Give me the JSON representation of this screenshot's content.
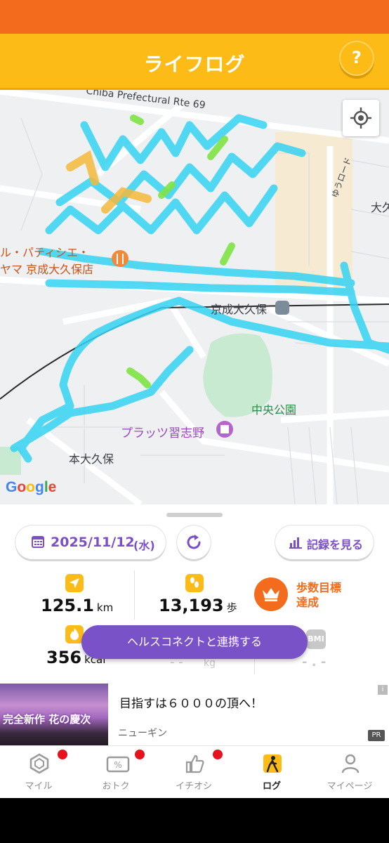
{
  "header": {
    "title": "ライフログ",
    "help_label": "?"
  },
  "map": {
    "labels": {
      "road_name": "Chiba Prefectural Rte 69",
      "yuu_road": "ゆうロード",
      "okubo_partial": "大久",
      "patisserie_line1": "ル・パティシエ・",
      "patisserie_line2": "ヤマ 京成大久保店",
      "station": "京成大久保",
      "park": "中央公園",
      "plats": "プラッツ習志野",
      "honokubo": "本大久保"
    },
    "google_logo": [
      "G",
      "o",
      "o",
      "g",
      "l",
      "e"
    ],
    "colors": {
      "route": "#35d3f3",
      "route_green": "#7ee342",
      "route_orange": "#f6b93b",
      "park": "#c8ead0"
    }
  },
  "panel": {
    "date": "2025/11/12",
    "day_of_week": "(水)",
    "record_label": "記録を見る",
    "distance": {
      "value": "125.1",
      "unit": "km"
    },
    "steps": {
      "value": "13,193",
      "unit": "歩"
    },
    "goal": {
      "line1": "歩数目標",
      "line2": "達成"
    },
    "calories": {
      "value": "356",
      "unit": "kcal"
    },
    "weight": {
      "value": "- -",
      "unit": "kg"
    },
    "bmi": {
      "label": "BMI",
      "value": "- . -"
    },
    "health_connect_label": "ヘルスコネクトと連携する"
  },
  "ad": {
    "image_text": "完全新作 花の慶次",
    "title": "目指すは６０００の頂へ！",
    "sponsor": "ニューギン",
    "pr_label": "PR",
    "info_label": "i"
  },
  "tabs": [
    {
      "label": "マイル",
      "icon": "mile-hexagon-icon",
      "badge": true,
      "active": false
    },
    {
      "label": "おトク",
      "icon": "coupon-icon",
      "badge": true,
      "active": false
    },
    {
      "label": "イチオシ",
      "icon": "thumbs-up-icon",
      "badge": true,
      "active": false
    },
    {
      "label": "ログ",
      "icon": "walking-icon",
      "badge": false,
      "active": true
    },
    {
      "label": "マイページ",
      "icon": "person-icon",
      "badge": false,
      "active": false
    }
  ],
  "colors": {
    "header": "#fdbb18",
    "statusbar": "#f36c1d",
    "accent_purple": "#7b4fc6",
    "goal_orange": "#f36c1d"
  }
}
